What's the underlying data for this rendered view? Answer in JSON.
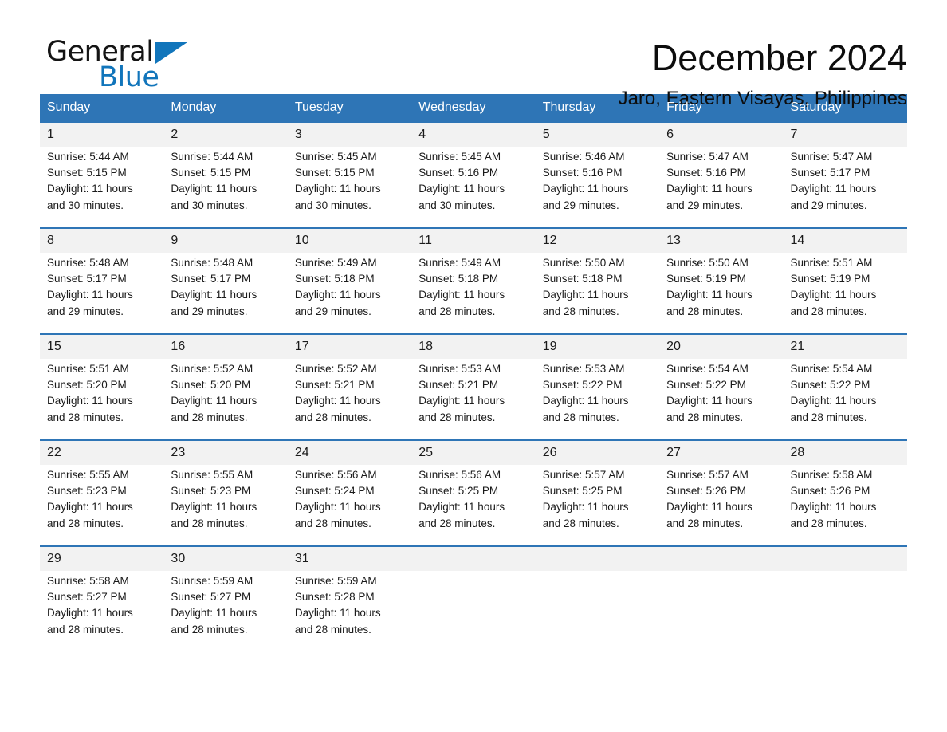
{
  "brand": {
    "name_part1": "General",
    "name_part2": "Blue",
    "accent_color": "#1175bb"
  },
  "header": {
    "month_title": "December 2024",
    "location": "Jaro, Eastern Visayas, Philippines"
  },
  "calendar": {
    "header_bg": "#2e75b6",
    "daynum_bg": "#f2f2f2",
    "weekday_headers": [
      "Sunday",
      "Monday",
      "Tuesday",
      "Wednesday",
      "Thursday",
      "Friday",
      "Saturday"
    ],
    "weeks": [
      [
        {
          "day": "1",
          "sunrise": "Sunrise: 5:44 AM",
          "sunset": "Sunset: 5:15 PM",
          "daylight_line1": "Daylight: 11 hours",
          "daylight_line2": "and 30 minutes."
        },
        {
          "day": "2",
          "sunrise": "Sunrise: 5:44 AM",
          "sunset": "Sunset: 5:15 PM",
          "daylight_line1": "Daylight: 11 hours",
          "daylight_line2": "and 30 minutes."
        },
        {
          "day": "3",
          "sunrise": "Sunrise: 5:45 AM",
          "sunset": "Sunset: 5:15 PM",
          "daylight_line1": "Daylight: 11 hours",
          "daylight_line2": "and 30 minutes."
        },
        {
          "day": "4",
          "sunrise": "Sunrise: 5:45 AM",
          "sunset": "Sunset: 5:16 PM",
          "daylight_line1": "Daylight: 11 hours",
          "daylight_line2": "and 30 minutes."
        },
        {
          "day": "5",
          "sunrise": "Sunrise: 5:46 AM",
          "sunset": "Sunset: 5:16 PM",
          "daylight_line1": "Daylight: 11 hours",
          "daylight_line2": "and 29 minutes."
        },
        {
          "day": "6",
          "sunrise": "Sunrise: 5:47 AM",
          "sunset": "Sunset: 5:16 PM",
          "daylight_line1": "Daylight: 11 hours",
          "daylight_line2": "and 29 minutes."
        },
        {
          "day": "7",
          "sunrise": "Sunrise: 5:47 AM",
          "sunset": "Sunset: 5:17 PM",
          "daylight_line1": "Daylight: 11 hours",
          "daylight_line2": "and 29 minutes."
        }
      ],
      [
        {
          "day": "8",
          "sunrise": "Sunrise: 5:48 AM",
          "sunset": "Sunset: 5:17 PM",
          "daylight_line1": "Daylight: 11 hours",
          "daylight_line2": "and 29 minutes."
        },
        {
          "day": "9",
          "sunrise": "Sunrise: 5:48 AM",
          "sunset": "Sunset: 5:17 PM",
          "daylight_line1": "Daylight: 11 hours",
          "daylight_line2": "and 29 minutes."
        },
        {
          "day": "10",
          "sunrise": "Sunrise: 5:49 AM",
          "sunset": "Sunset: 5:18 PM",
          "daylight_line1": "Daylight: 11 hours",
          "daylight_line2": "and 29 minutes."
        },
        {
          "day": "11",
          "sunrise": "Sunrise: 5:49 AM",
          "sunset": "Sunset: 5:18 PM",
          "daylight_line1": "Daylight: 11 hours",
          "daylight_line2": "and 28 minutes."
        },
        {
          "day": "12",
          "sunrise": "Sunrise: 5:50 AM",
          "sunset": "Sunset: 5:18 PM",
          "daylight_line1": "Daylight: 11 hours",
          "daylight_line2": "and 28 minutes."
        },
        {
          "day": "13",
          "sunrise": "Sunrise: 5:50 AM",
          "sunset": "Sunset: 5:19 PM",
          "daylight_line1": "Daylight: 11 hours",
          "daylight_line2": "and 28 minutes."
        },
        {
          "day": "14",
          "sunrise": "Sunrise: 5:51 AM",
          "sunset": "Sunset: 5:19 PM",
          "daylight_line1": "Daylight: 11 hours",
          "daylight_line2": "and 28 minutes."
        }
      ],
      [
        {
          "day": "15",
          "sunrise": "Sunrise: 5:51 AM",
          "sunset": "Sunset: 5:20 PM",
          "daylight_line1": "Daylight: 11 hours",
          "daylight_line2": "and 28 minutes."
        },
        {
          "day": "16",
          "sunrise": "Sunrise: 5:52 AM",
          "sunset": "Sunset: 5:20 PM",
          "daylight_line1": "Daylight: 11 hours",
          "daylight_line2": "and 28 minutes."
        },
        {
          "day": "17",
          "sunrise": "Sunrise: 5:52 AM",
          "sunset": "Sunset: 5:21 PM",
          "daylight_line1": "Daylight: 11 hours",
          "daylight_line2": "and 28 minutes."
        },
        {
          "day": "18",
          "sunrise": "Sunrise: 5:53 AM",
          "sunset": "Sunset: 5:21 PM",
          "daylight_line1": "Daylight: 11 hours",
          "daylight_line2": "and 28 minutes."
        },
        {
          "day": "19",
          "sunrise": "Sunrise: 5:53 AM",
          "sunset": "Sunset: 5:22 PM",
          "daylight_line1": "Daylight: 11 hours",
          "daylight_line2": "and 28 minutes."
        },
        {
          "day": "20",
          "sunrise": "Sunrise: 5:54 AM",
          "sunset": "Sunset: 5:22 PM",
          "daylight_line1": "Daylight: 11 hours",
          "daylight_line2": "and 28 minutes."
        },
        {
          "day": "21",
          "sunrise": "Sunrise: 5:54 AM",
          "sunset": "Sunset: 5:22 PM",
          "daylight_line1": "Daylight: 11 hours",
          "daylight_line2": "and 28 minutes."
        }
      ],
      [
        {
          "day": "22",
          "sunrise": "Sunrise: 5:55 AM",
          "sunset": "Sunset: 5:23 PM",
          "daylight_line1": "Daylight: 11 hours",
          "daylight_line2": "and 28 minutes."
        },
        {
          "day": "23",
          "sunrise": "Sunrise: 5:55 AM",
          "sunset": "Sunset: 5:23 PM",
          "daylight_line1": "Daylight: 11 hours",
          "daylight_line2": "and 28 minutes."
        },
        {
          "day": "24",
          "sunrise": "Sunrise: 5:56 AM",
          "sunset": "Sunset: 5:24 PM",
          "daylight_line1": "Daylight: 11 hours",
          "daylight_line2": "and 28 minutes."
        },
        {
          "day": "25",
          "sunrise": "Sunrise: 5:56 AM",
          "sunset": "Sunset: 5:25 PM",
          "daylight_line1": "Daylight: 11 hours",
          "daylight_line2": "and 28 minutes."
        },
        {
          "day": "26",
          "sunrise": "Sunrise: 5:57 AM",
          "sunset": "Sunset: 5:25 PM",
          "daylight_line1": "Daylight: 11 hours",
          "daylight_line2": "and 28 minutes."
        },
        {
          "day": "27",
          "sunrise": "Sunrise: 5:57 AM",
          "sunset": "Sunset: 5:26 PM",
          "daylight_line1": "Daylight: 11 hours",
          "daylight_line2": "and 28 minutes."
        },
        {
          "day": "28",
          "sunrise": "Sunrise: 5:58 AM",
          "sunset": "Sunset: 5:26 PM",
          "daylight_line1": "Daylight: 11 hours",
          "daylight_line2": "and 28 minutes."
        }
      ],
      [
        {
          "day": "29",
          "sunrise": "Sunrise: 5:58 AM",
          "sunset": "Sunset: 5:27 PM",
          "daylight_line1": "Daylight: 11 hours",
          "daylight_line2": "and 28 minutes."
        },
        {
          "day": "30",
          "sunrise": "Sunrise: 5:59 AM",
          "sunset": "Sunset: 5:27 PM",
          "daylight_line1": "Daylight: 11 hours",
          "daylight_line2": "and 28 minutes."
        },
        {
          "day": "31",
          "sunrise": "Sunrise: 5:59 AM",
          "sunset": "Sunset: 5:28 PM",
          "daylight_line1": "Daylight: 11 hours",
          "daylight_line2": "and 28 minutes."
        },
        {
          "day": "",
          "sunrise": "",
          "sunset": "",
          "daylight_line1": "",
          "daylight_line2": ""
        },
        {
          "day": "",
          "sunrise": "",
          "sunset": "",
          "daylight_line1": "",
          "daylight_line2": ""
        },
        {
          "day": "",
          "sunrise": "",
          "sunset": "",
          "daylight_line1": "",
          "daylight_line2": ""
        },
        {
          "day": "",
          "sunrise": "",
          "sunset": "",
          "daylight_line1": "",
          "daylight_line2": ""
        }
      ]
    ]
  }
}
